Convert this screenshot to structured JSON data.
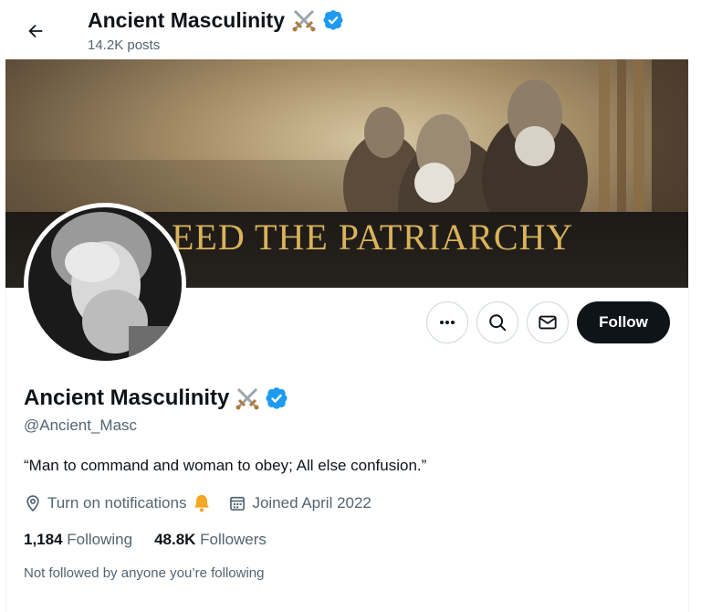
{
  "header": {
    "display_name": "Ancient Masculinity",
    "posts_count": "14.2K posts"
  },
  "banner": {
    "text": "EED THE PATRIARCHY"
  },
  "actions": {
    "follow_label": "Follow"
  },
  "profile": {
    "display_name": "Ancient Masculinity",
    "handle": "@Ancient_Masc",
    "bio": "“Man to command and woman to obey; All else confusion.”",
    "notifications_label": "Turn on notifications",
    "joined": "Joined April 2022",
    "following_count": "1,184",
    "following_label": "Following",
    "followers_count": "48.8K",
    "followers_label": "Followers",
    "not_followed_text": "Not followed by anyone you’re following"
  },
  "icons": {
    "back": "arrow-left-icon",
    "verified": "verified-badge-icon",
    "name_emoji": "crossed-swords-icon",
    "more": "more-dots-icon",
    "search": "search-icon",
    "message": "envelope-icon",
    "location": "location-pin-icon",
    "bell": "bell-icon",
    "calendar": "calendar-icon"
  },
  "colors": {
    "verified": "#1d9bf0",
    "follow_bg": "#0f1419",
    "secondary_text": "#536471",
    "bell": "#f5a623"
  }
}
